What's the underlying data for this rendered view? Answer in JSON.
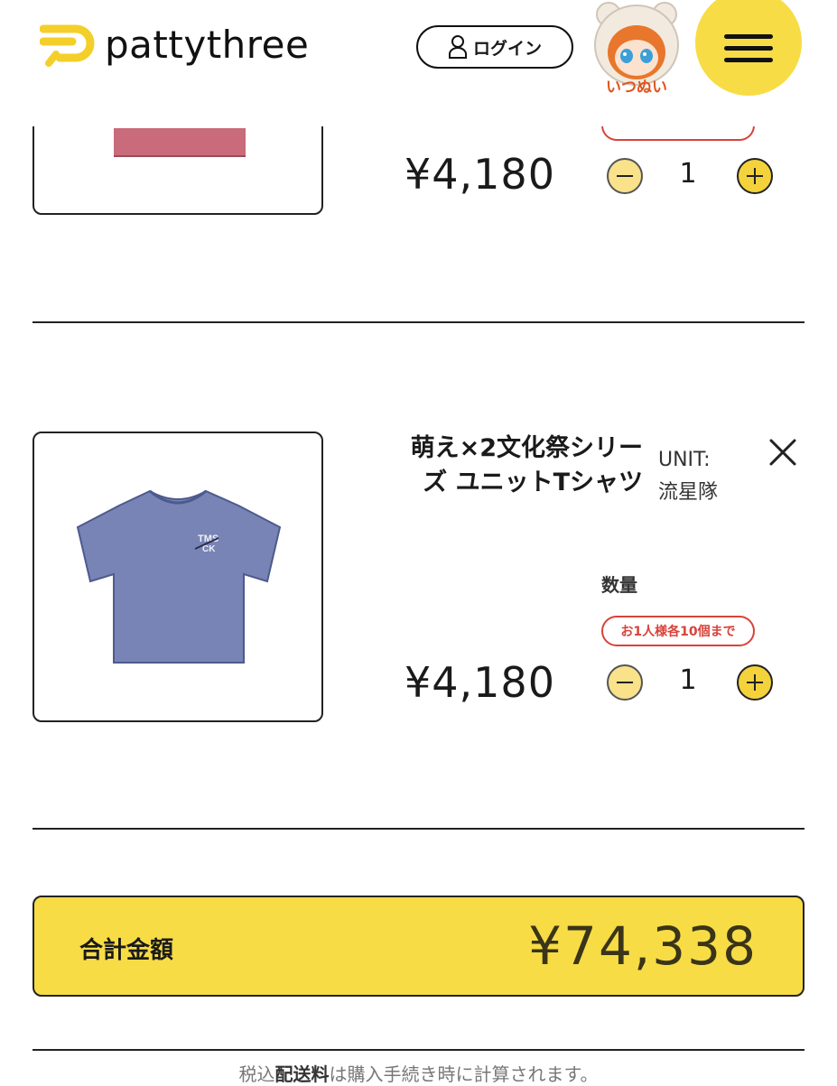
{
  "header": {
    "logo_text": "pattythree",
    "login_label": "ログイン",
    "avatar_caption": "いつぬい",
    "colors": {
      "accent": "#f7dc45"
    }
  },
  "items": [
    {
      "price": "¥4,180",
      "quantity": "1"
    },
    {
      "name_line1": "萌え×2文化祭シリー",
      "name_line2": "ズ ユニットTシャツ",
      "variant_key": "UNIT:",
      "variant_value": "流星隊",
      "image_text_top": "TMS",
      "image_text_bottom": "CK",
      "quantity_label": "数量",
      "limit_note": "お1人様各10個まで",
      "price": "¥4,180",
      "quantity": "1"
    }
  ],
  "summary": {
    "total_label": "合計金額",
    "total_value": "¥74,338",
    "note_prefix": "税込",
    "note_bold": "配送料",
    "note_suffix": "は購入手続き時に計算されます。"
  },
  "icons": [
    "logo-mark-icon",
    "user-icon",
    "hamburger-icon",
    "close-icon",
    "minus-icon",
    "plus-icon"
  ]
}
